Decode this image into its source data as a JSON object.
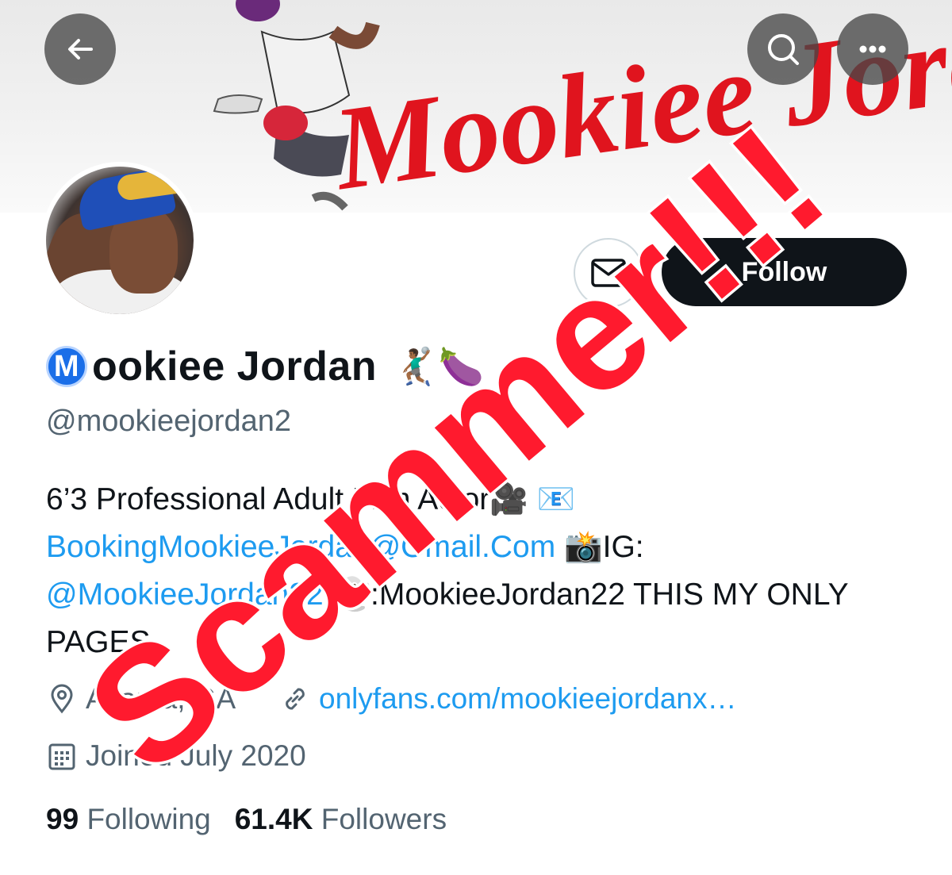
{
  "banner": {
    "art_text": "Mookiee Jordan",
    "icons": {
      "back": "arrow-left-icon",
      "search": "search-icon",
      "more": "more-horizontal-icon"
    }
  },
  "profile": {
    "name_badge": "M",
    "display_name": "ookiee Jordan",
    "name_emojis": "🤾🏾‍♂️🍆",
    "handle": "@mookieejordan2",
    "follow_label": "Follow",
    "message_icon": "envelope-icon"
  },
  "bio": {
    "line1_text": "6’3 Professional Adult Film Actor🎥 📧",
    "email": "BookingMookieeJordan@Gmail.Com",
    "ig_label": " 📸IG:",
    "ig_handle": "@MookieeJordan22",
    "snap_text": " 👻:MookieeJordan22 THIS MY ONLY PAGES"
  },
  "meta": {
    "location": "Atlanta, GA",
    "url": "onlyfans.com/mookieejordanx…",
    "joined": "Joined July 2020"
  },
  "stats": {
    "following_count": "99",
    "following_label": "Following",
    "followers_count": "61.4K",
    "followers_label": "Followers"
  },
  "overlay": {
    "text": "Scammer!!!",
    "color": "#ff1a2e"
  },
  "colors": {
    "link": "#1d9bf0",
    "secondary_text": "#536471",
    "follow_bg": "#0f1419",
    "banner_text": "#e0141e"
  }
}
